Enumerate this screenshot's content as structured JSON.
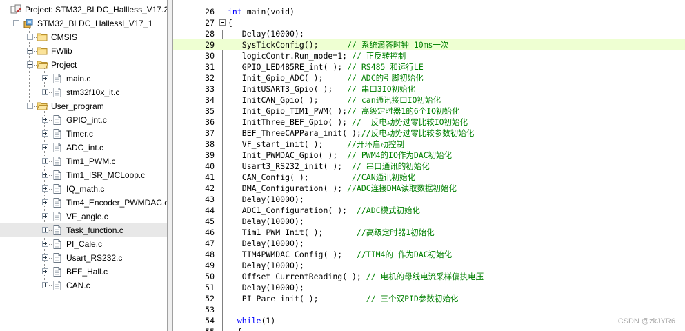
{
  "project_tree": {
    "items": [
      {
        "level": 0,
        "label": "Project: STM32_BLDC_Hallless_V17.2",
        "icon": "project-workspace-icon",
        "expander": "none"
      },
      {
        "level": 1,
        "label": "STM32_BLDC_Hallessl_V17_1",
        "icon": "target-icon",
        "expander": "minus"
      },
      {
        "level": 2,
        "label": "CMSIS",
        "icon": "folder-icon",
        "expander": "plus"
      },
      {
        "level": 2,
        "label": "FWlib",
        "icon": "folder-icon",
        "expander": "plus"
      },
      {
        "level": 2,
        "label": "Project",
        "icon": "folder-open-icon",
        "expander": "minus"
      },
      {
        "level": 3,
        "label": "main.c",
        "icon": "source-file-icon",
        "expander": "plus"
      },
      {
        "level": 3,
        "label": "stm32f10x_it.c",
        "icon": "source-file-icon",
        "expander": "plus"
      },
      {
        "level": 2,
        "label": "User_program",
        "icon": "folder-open-icon",
        "expander": "minus"
      },
      {
        "level": 3,
        "label": "GPIO_int.c",
        "icon": "source-file-icon",
        "expander": "plus"
      },
      {
        "level": 3,
        "label": "Timer.c",
        "icon": "source-file-icon",
        "expander": "plus"
      },
      {
        "level": 3,
        "label": "ADC_int.c",
        "icon": "source-file-icon",
        "expander": "plus"
      },
      {
        "level": 3,
        "label": "Tim1_PWM.c",
        "icon": "source-file-icon",
        "expander": "plus"
      },
      {
        "level": 3,
        "label": "Tim1_ISR_MCLoop.c",
        "icon": "source-file-icon",
        "expander": "plus"
      },
      {
        "level": 3,
        "label": "IQ_math.c",
        "icon": "source-file-icon",
        "expander": "plus"
      },
      {
        "level": 3,
        "label": "Tim4_Encoder_PWMDAC.c",
        "icon": "source-file-icon",
        "expander": "plus"
      },
      {
        "level": 3,
        "label": "VF_angle.c",
        "icon": "source-file-icon",
        "expander": "plus"
      },
      {
        "level": 3,
        "label": "Task_function.c",
        "icon": "source-file-icon",
        "expander": "plus",
        "highlighted": true
      },
      {
        "level": 3,
        "label": "PI_Cale.c",
        "icon": "source-file-icon",
        "expander": "plus"
      },
      {
        "level": 3,
        "label": "Usart_RS232.c",
        "icon": "source-file-icon",
        "expander": "plus"
      },
      {
        "level": 3,
        "label": "BEF_Hall.c",
        "icon": "source-file-icon",
        "expander": "plus"
      },
      {
        "level": 3,
        "label": "CAN.c",
        "icon": "source-file-icon",
        "expander": "plus"
      }
    ]
  },
  "editor": {
    "current_line": 29,
    "lines": [
      {
        "no": "26",
        "code": "int main(void)",
        "comment": "",
        "fold": false,
        "kw": "int"
      },
      {
        "no": "27",
        "code": "{",
        "comment": "",
        "fold": true
      },
      {
        "no": "28",
        "code": "   Delay(10000);",
        "comment": ""
      },
      {
        "no": "29",
        "code": "   SysTickConfig();      ",
        "comment": "// 系统滴答时钟 10ms一次"
      },
      {
        "no": "30",
        "code": "   logicContr.Run_mode=1; ",
        "comment": "// 正反转控制"
      },
      {
        "no": "31",
        "code": "   GPIO_LED485RE_int( ); ",
        "comment": "// RS485 和运行LE"
      },
      {
        "no": "32",
        "code": "   Init_Gpio_ADC( );     ",
        "comment": "// ADC的引脚初始化"
      },
      {
        "no": "33",
        "code": "   InitUSART3_Gpio( );   ",
        "comment": "// 串口3IO初始化"
      },
      {
        "no": "34",
        "code": "   InitCAN_Gpio( );      ",
        "comment": "// can通讯接口IO初始化"
      },
      {
        "no": "35",
        "code": "   Init_Gpio_TIM1_PWM( );",
        "comment": "// 高级定时器1的6个IO初始化"
      },
      {
        "no": "36",
        "code": "   InitThree_BEF_Gpio( ); ",
        "comment": "//  反电动势过零比较IO初始化"
      },
      {
        "no": "37",
        "code": "   BEF_ThreeCAPPara_init( );",
        "comment": "//反电动势过零比较参数初始化"
      },
      {
        "no": "38",
        "code": "   VF_start_init( );     ",
        "comment": "//开环启动控制"
      },
      {
        "no": "39",
        "code": "   Init_PWMDAC_Gpio( );  ",
        "comment": "// PWM4的IO作为DAC初始化"
      },
      {
        "no": "40",
        "code": "   Usart3_RS232_init( );  ",
        "comment": "// 串口通讯的初始化"
      },
      {
        "no": "41",
        "code": "   CAN_Config( );         ",
        "comment": "//CAN通讯初始化"
      },
      {
        "no": "42",
        "code": "   DMA_Configuration( ); ",
        "comment": "//ADC连接DMA读取数据初始化"
      },
      {
        "no": "43",
        "code": "   Delay(10000);",
        "comment": ""
      },
      {
        "no": "44",
        "code": "   ADC1_Configuration( );  ",
        "comment": "//ADC模式初始化"
      },
      {
        "no": "45",
        "code": "   Delay(10000);",
        "comment": ""
      },
      {
        "no": "46",
        "code": "   Tim1_PWM_Init( );       ",
        "comment": "//高级定时器1初始化"
      },
      {
        "no": "47",
        "code": "   Delay(10000);",
        "comment": ""
      },
      {
        "no": "48",
        "code": "   TIM4PWMDAC_Config( );   ",
        "comment": "//TIM4的 作为DAC初始化"
      },
      {
        "no": "49",
        "code": "   Delay(10000);",
        "comment": ""
      },
      {
        "no": "50",
        "code": "   Offset_CurrentReading( ); ",
        "comment": "// 电机的母线电流采样偏执电压"
      },
      {
        "no": "51",
        "code": "   Delay(10000);",
        "comment": ""
      },
      {
        "no": "52",
        "code": "   PI_Pare_init( );          ",
        "comment": "// 三个双PID参数初始化"
      },
      {
        "no": "53",
        "code": "",
        "comment": ""
      },
      {
        "no": "54",
        "code": "  while(1)",
        "comment": "",
        "kw": "while"
      },
      {
        "no": "55",
        "code": "  {",
        "comment": ""
      }
    ]
  },
  "watermark": "CSDN @zkJYR6",
  "colors": {
    "keyword": "#0000ff",
    "comment": "#008000",
    "current_line_bg": "#eeffd2",
    "highlight_row_bg": "#e8e8e8"
  }
}
